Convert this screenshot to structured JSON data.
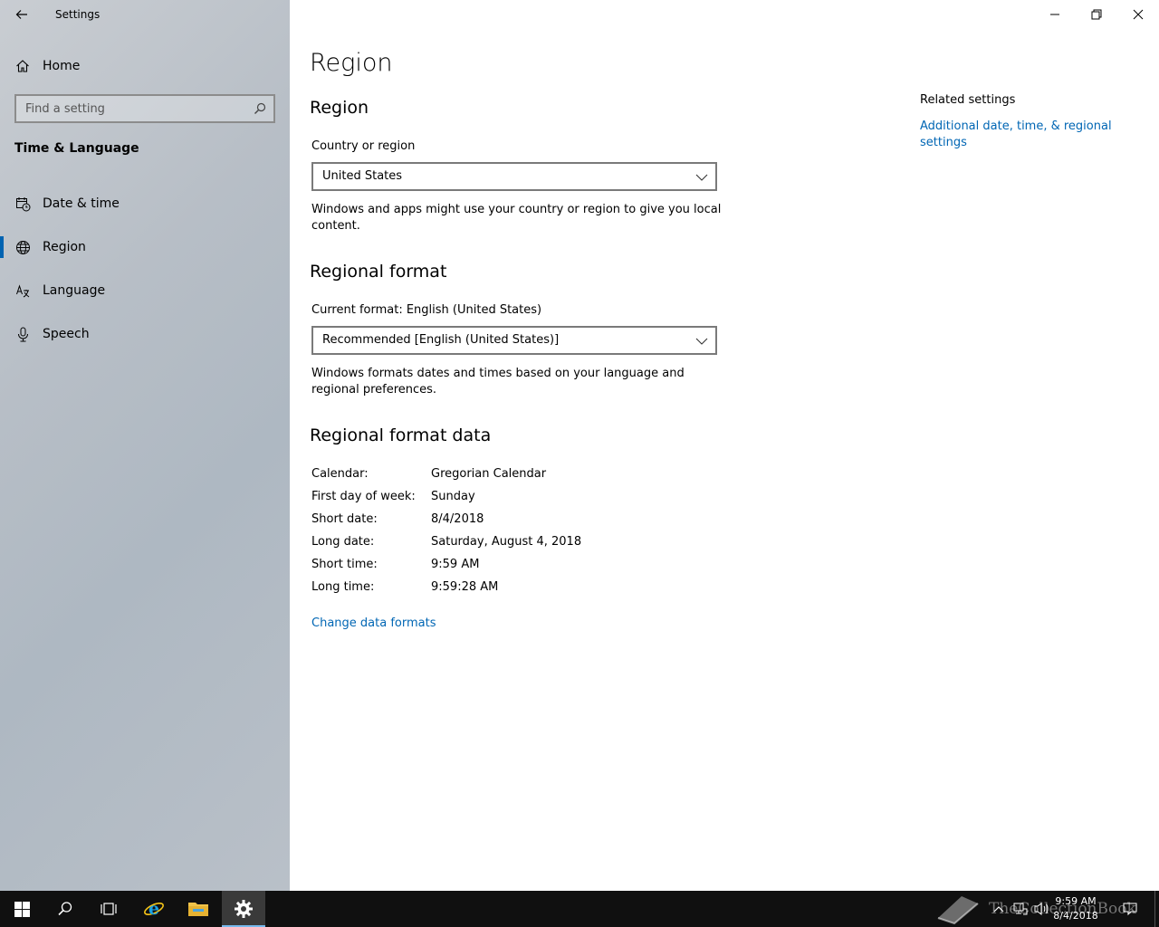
{
  "window": {
    "app_title": "Settings"
  },
  "sidebar": {
    "home_label": "Home",
    "search_placeholder": "Find a setting",
    "section_heading": "Time & Language",
    "items": [
      {
        "label": "Date & time",
        "icon": "calendar-clock-icon",
        "selected": false
      },
      {
        "label": "Region",
        "icon": "globe-icon",
        "selected": true
      },
      {
        "label": "Language",
        "icon": "language-icon",
        "selected": false
      },
      {
        "label": "Speech",
        "icon": "microphone-icon",
        "selected": false
      }
    ]
  },
  "main": {
    "page_title": "Region",
    "region_section": {
      "heading": "Region",
      "country_label": "Country or region",
      "country_value": "United States",
      "description": "Windows and apps might use your country or region to give you local content."
    },
    "format_section": {
      "heading": "Regional format",
      "current_format_label": "Current format: English (United States)",
      "format_value": "Recommended [English (United States)]",
      "description": "Windows formats dates and times based on your language and regional preferences."
    },
    "format_data_section": {
      "heading": "Regional format data",
      "rows": [
        {
          "key": "Calendar:",
          "value": "Gregorian Calendar"
        },
        {
          "key": "First day of week:",
          "value": "Sunday"
        },
        {
          "key": "Short date:",
          "value": "8/4/2018"
        },
        {
          "key": "Long date:",
          "value": "Saturday, August 4, 2018"
        },
        {
          "key": "Short time:",
          "value": "9:59 AM"
        },
        {
          "key": "Long time:",
          "value": "9:59:28 AM"
        }
      ],
      "change_link": "Change data formats"
    },
    "related": {
      "title": "Related settings",
      "link": "Additional date, time, & regional settings"
    }
  },
  "taskbar": {
    "clock_time": "9:59 AM",
    "clock_date": "8/4/2018",
    "watermark": "TheCollectionBook",
    "accent_color": "#76b9ed"
  },
  "colors": {
    "link": "#0066b4",
    "selection_bar": "#0063b1",
    "taskbar_bg": "#101010"
  }
}
